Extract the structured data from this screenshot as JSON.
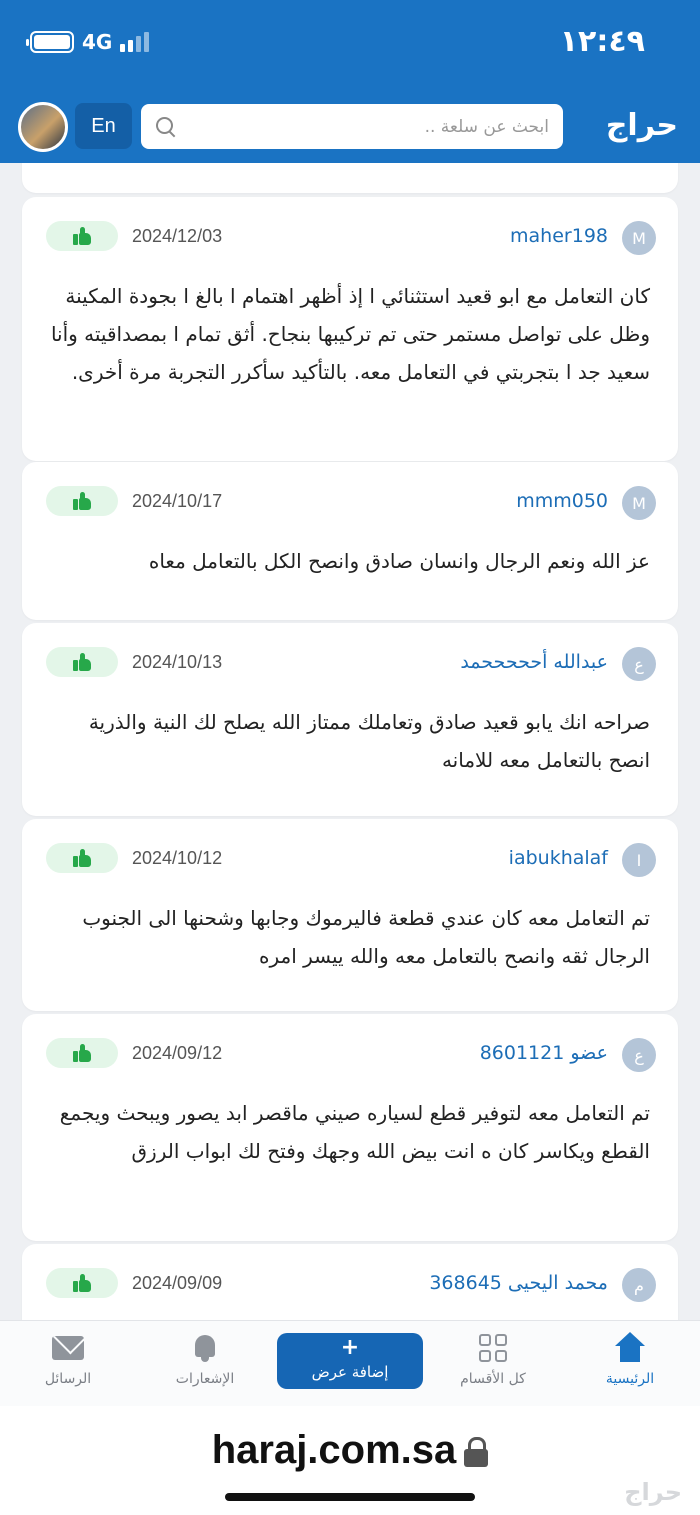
{
  "status_bar": {
    "time": "١٢:٤٩",
    "network": "4G"
  },
  "header": {
    "logo": "حراج",
    "search_placeholder": "ابحث عن سلعة ..",
    "lang_button": "En"
  },
  "reviews": [
    {
      "initial": "M",
      "username": "maher198",
      "date": "2024/12/03",
      "text": "كان التعامل مع ابو قعيد استثنائي ا إذ أظهر اهتمام ا بالغ ا بجودة المكينة وظل على تواصل مستمر حتى تم تركيبها بنجاح. أثق تمام ا بمصداقيته وأنا سعيد جد ا بتجربتي في التعامل معه. بالتأكيد سأكرر التجربة مرة أخرى."
    },
    {
      "initial": "M",
      "username": "mmm050",
      "date": "2024/10/17",
      "text": "عز الله ونعم الرجال وانسان صادق وانصح الكل بالتعامل معاه"
    },
    {
      "initial": "ع",
      "username": "عبدالله أحححححمد",
      "date": "2024/10/13",
      "text": "صراحه انك يابو قعيد صادق وتعاملك ممتاز الله يصلح لك النية والذرية انصح بالتعامل معه للامانه"
    },
    {
      "initial": "I",
      "username": "iabukhalaf",
      "date": "2024/10/12",
      "text": "تم التعامل معه كان عندي قطعة فاليرموك وجابها وشحنها الى الجنوب الرجال ثقه وانصح بالتعامل معه والله ييسر امره"
    },
    {
      "initial": "ع",
      "username": "عضو 8601121",
      "date": "2024/09/12",
      "text": "تم التعامل معه لتوفير قطع لسياره صيني ماقصر ابد يصور ويبحث ويجمع القطع ويكاسر كان ه انت بيض الله وجهك وفتح لك ابواب الرزق"
    },
    {
      "initial": "م",
      "username": "محمد اليحيى 368645",
      "date": "2024/09/09",
      "text": ""
    }
  ],
  "bottom_nav": {
    "home": "الرئيسية",
    "categories": "كل الأقسام",
    "add_offer": "إضافة عرض",
    "add_plus": "+",
    "notifications": "الإشعارات",
    "messages": "الرسائل"
  },
  "browser": {
    "url": "haraj.com.sa"
  },
  "watermark": "حراج",
  "colors": {
    "brand": "#1a73c3",
    "like_bg": "#e3f6e8",
    "like_icon": "#27a84a"
  }
}
